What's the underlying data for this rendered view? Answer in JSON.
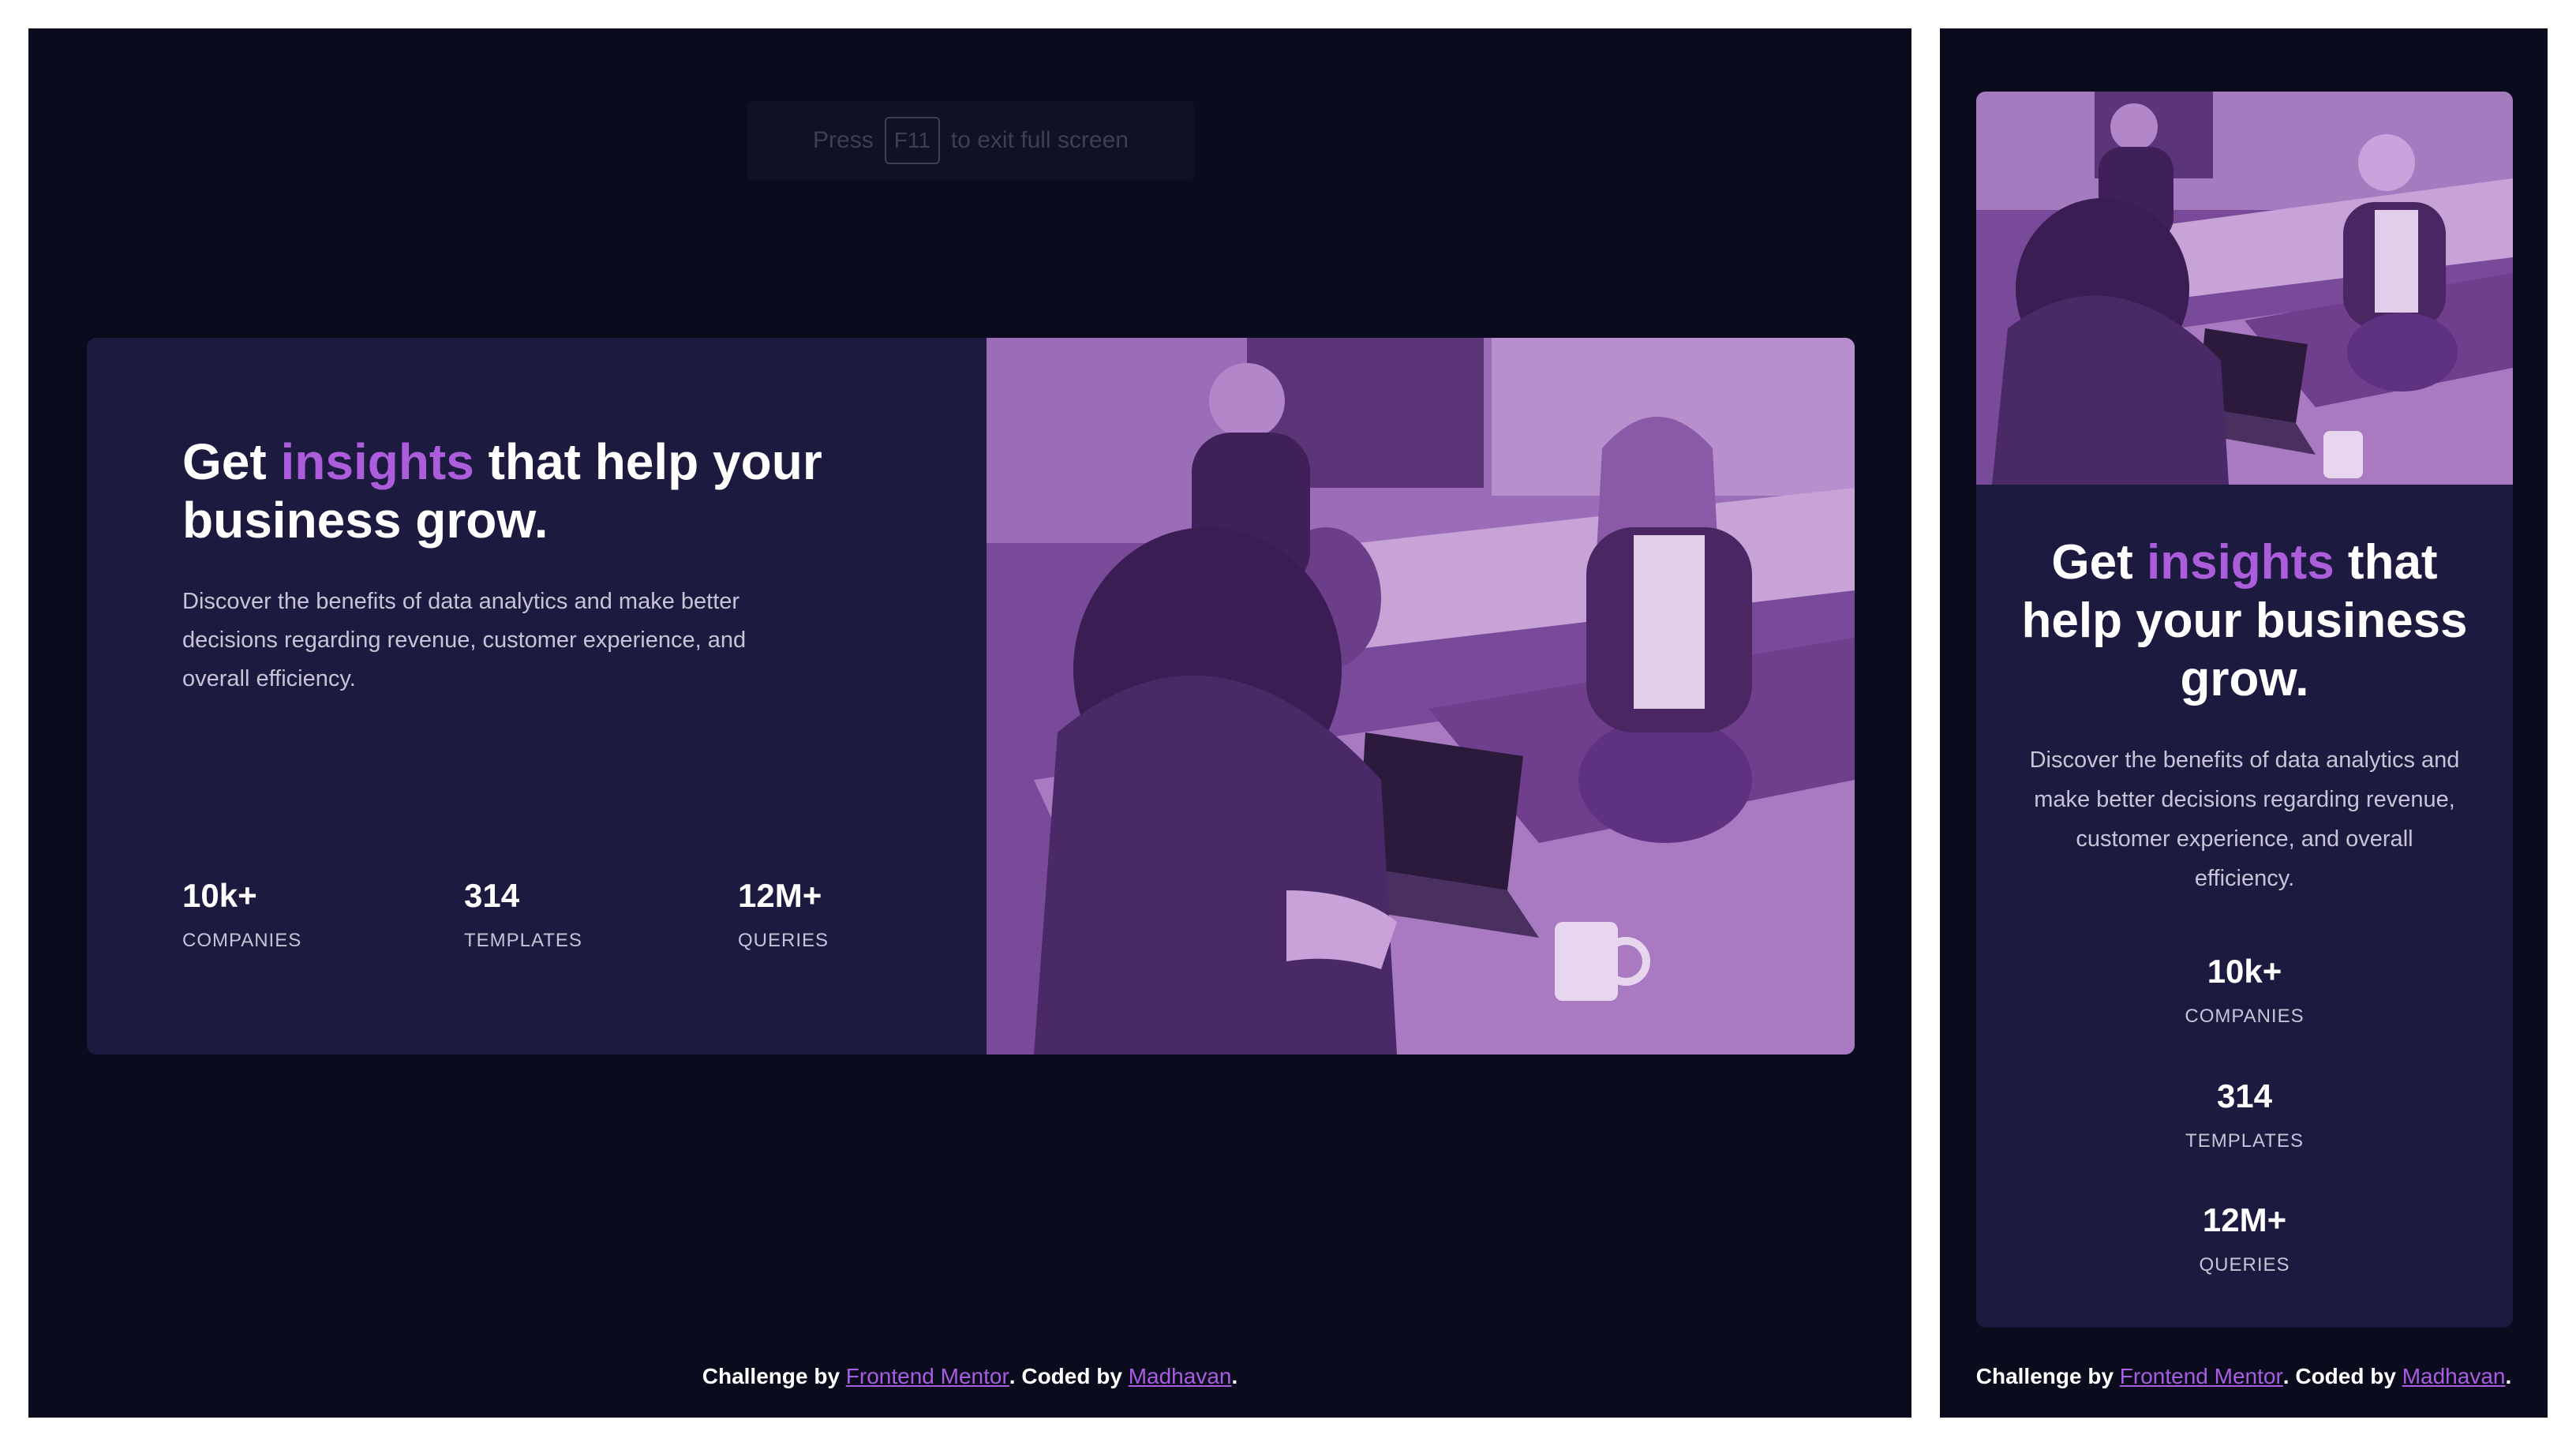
{
  "fullscreen_notice": {
    "prefix": "Press",
    "key": "F11",
    "suffix": "to exit full screen"
  },
  "card": {
    "title_start": "Get",
    "title_highlight": "insights",
    "title_end": "that help your business grow.",
    "description": "Discover the benefits of data analytics and make better decisions regarding revenue, customer experience, and overall efficiency.",
    "image_alt": "Two women working at laptops in an office",
    "stats": [
      {
        "value": "10k+",
        "label": "COMPANIES"
      },
      {
        "value": "314",
        "label": "TEMPLATES"
      },
      {
        "value": "12M+",
        "label": "QUERIES"
      }
    ]
  },
  "footer": {
    "prefix": "Challenge by",
    "link1": "Frontend Mentor",
    "middle": ". Coded by",
    "link2": "Madhavan",
    "suffix": "."
  },
  "colors": {
    "page_bg": "#0a0c1d",
    "card_bg": "#1c1a3f",
    "accent": "#ab5ddb",
    "link": "#a95de3",
    "text": "#ffffff",
    "muted_text": "#c6c4d6"
  }
}
